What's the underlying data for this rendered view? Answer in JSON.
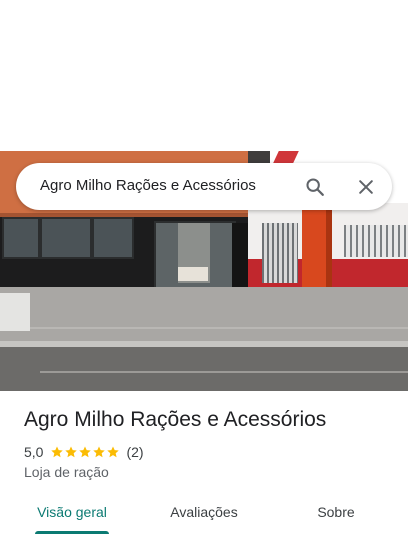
{
  "search": {
    "query": "Agro Milho Rações e Acessórios",
    "search_icon": "search-icon",
    "close_icon": "close-icon"
  },
  "place": {
    "name": "Agro Milho Rações e Acessórios",
    "rating": "5,0",
    "stars": 5,
    "review_count": "(2)",
    "category": "Loja de ração"
  },
  "tabs": [
    {
      "label": "Visão geral",
      "active": true
    },
    {
      "label": "Avaliações",
      "active": false
    },
    {
      "label": "Sobre",
      "active": false
    }
  ],
  "colors": {
    "accent": "#0b7a72",
    "star": "#fbbc04",
    "text": "#202124",
    "secondary_text": "#5f6368"
  }
}
